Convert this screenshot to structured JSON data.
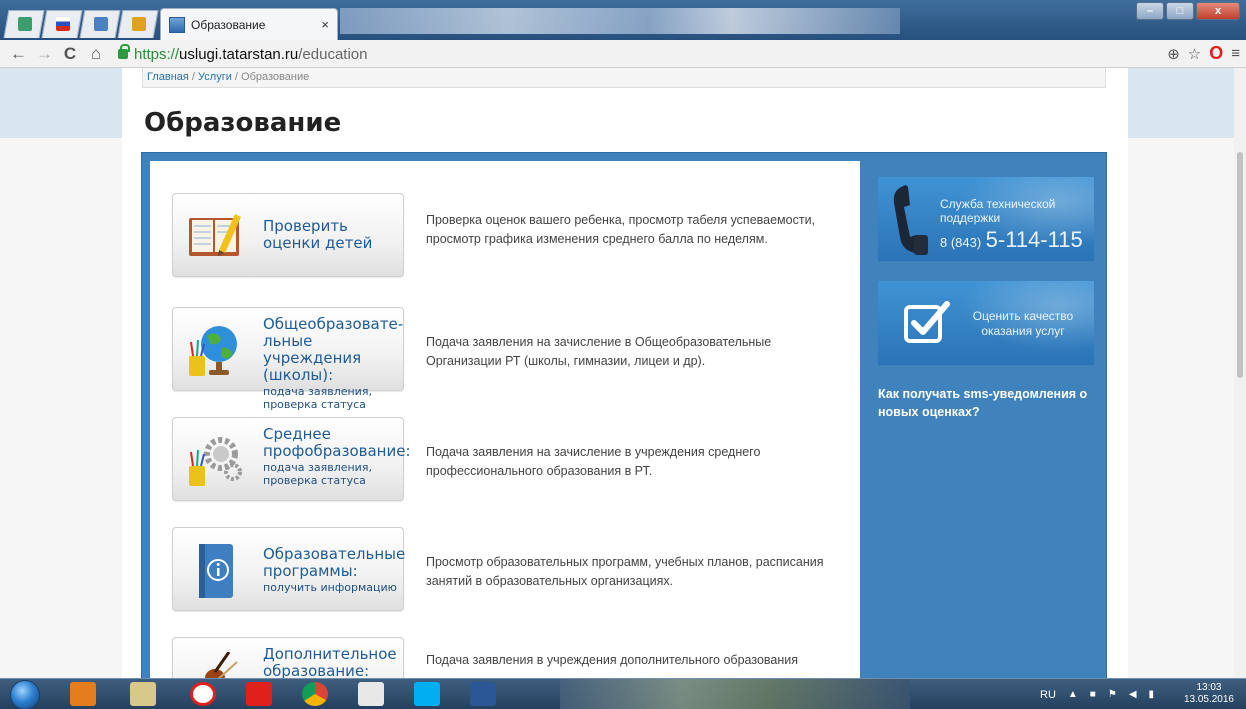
{
  "browser": {
    "active_tab_title": "Образование",
    "close_glyph": "×",
    "url_scheme": "https://",
    "url_host": "uslugi.tatarstan.ru",
    "url_path": "/education",
    "nav_back_glyph": "←",
    "nav_forward_glyph": "→",
    "reload_glyph": "C",
    "home_glyph": "⌂",
    "zoom_glyph": "⊕",
    "star_glyph": "☆",
    "opera_glyph": "O",
    "menu_glyph": "≡",
    "minimize_glyph": "–",
    "maximize_glyph": "□",
    "window_close_glyph": "x"
  },
  "breadcrumb": {
    "home": "Главная",
    "services": "Услуги",
    "current": "Образование",
    "separator": " / "
  },
  "page_title": "Образование",
  "services": [
    {
      "title": "Проверить оценки детей",
      "subtitle": "",
      "description": "Проверка оценок вашего ребенка, просмотр табеля успеваемости, просмотр графика изменения среднего балла по неделям.",
      "icon": "gradebook-icon"
    },
    {
      "title": "Общеобразовате-льные учреждения (школы):",
      "subtitle": "подача заявления, проверка статуса",
      "description": "Подача заявления на зачисление в Общеобразовательные Организации РТ (школы, гимназии, лицеи и др).",
      "icon": "globe-icon"
    },
    {
      "title": "Среднее профобразование:",
      "subtitle": "подача заявления, проверка статуса",
      "description": "Подача заявления на зачисление в учреждения среднего профессионального образования в РТ.",
      "icon": "gears-icon"
    },
    {
      "title": "Образовательные программы:",
      "subtitle": "получить информацию",
      "description": "Просмотр образовательных программ, учебных планов, расписания занятий в образовательных организациях.",
      "icon": "info-book-icon"
    },
    {
      "title": "Дополнительное образование:",
      "subtitle": "",
      "description": "Подача заявления в учреждения дополнительного образования",
      "icon": "violin-icon"
    }
  ],
  "sidebar": {
    "support_title": "Служба технической поддержки",
    "support_code": "8 (843)",
    "support_number": "5-114-115",
    "quality_title": "Оценить качество оказания услуг",
    "sms_link": "Как получать sms-уведомления о новых оценках?"
  },
  "taskbar": {
    "language": "RU",
    "time": "13:03",
    "date": "13.05.2016"
  },
  "colors": {
    "panel_blue": "#4082bc",
    "link_blue": "#1f5b95",
    "promo_blue": "#2b73b6"
  }
}
